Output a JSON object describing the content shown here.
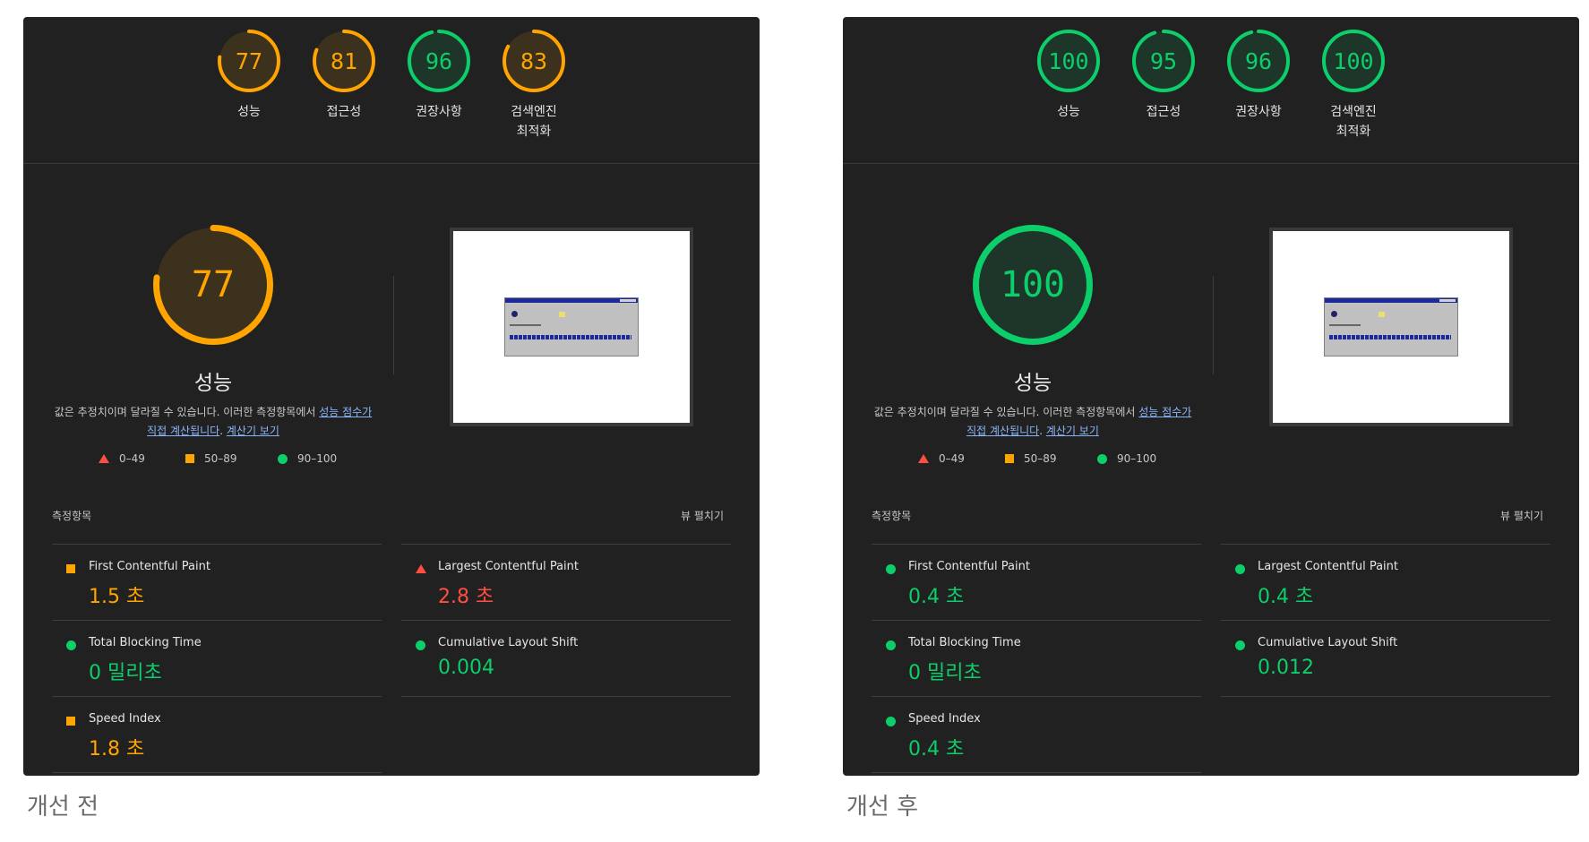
{
  "colors": {
    "pass": "#0cce6b",
    "average": "#ffa400",
    "fail": "#ff4e42",
    "panel_bg": "#212121"
  },
  "panels": [
    {
      "caption": "개선 전",
      "categories": [
        {
          "score": "77",
          "label": "성능",
          "status": "average",
          "fraction": 0.77
        },
        {
          "score": "81",
          "label": "접근성",
          "status": "average",
          "fraction": 0.81
        },
        {
          "score": "96",
          "label": "권장사항",
          "status": "pass",
          "fraction": 0.96
        },
        {
          "score": "83",
          "label": "검색엔진\n최적화",
          "status": "average",
          "fraction": 0.83
        }
      ],
      "performance": {
        "score": "77",
        "status": "average",
        "fraction": 0.77,
        "title": "성능",
        "desc_prefix": "값은 추정치이며 달라질 수 있습니다. 이러한 측정항목에서 ",
        "desc_link1": "성능 점수가 직접 계산됩니다",
        "desc_mid": ". ",
        "desc_link2": "계산기 보기"
      },
      "legend": {
        "fail": "0–49",
        "average": "50–89",
        "pass": "90–100"
      },
      "metrics_title": "측정항목",
      "expand_label": "뷰 펼치기",
      "metrics": {
        "fcp": {
          "name": "First Contentful Paint",
          "value": "1.5 초",
          "status": "average"
        },
        "lcp": {
          "name": "Largest Contentful Paint",
          "value": "2.8 초",
          "status": "fail"
        },
        "tbt": {
          "name": "Total Blocking Time",
          "value": "0 밀리초",
          "status": "pass"
        },
        "cls": {
          "name": "Cumulative Layout Shift",
          "value": "0.004",
          "status": "pass"
        },
        "si": {
          "name": "Speed Index",
          "value": "1.8 초",
          "status": "average"
        }
      }
    },
    {
      "caption": "개선 후",
      "categories": [
        {
          "score": "100",
          "label": "성능",
          "status": "pass",
          "fraction": 1.0
        },
        {
          "score": "95",
          "label": "접근성",
          "status": "pass",
          "fraction": 0.95
        },
        {
          "score": "96",
          "label": "권장사항",
          "status": "pass",
          "fraction": 0.96
        },
        {
          "score": "100",
          "label": "검색엔진\n최적화",
          "status": "pass",
          "fraction": 1.0
        }
      ],
      "performance": {
        "score": "100",
        "status": "pass",
        "fraction": 1.0,
        "title": "성능",
        "desc_prefix": "값은 추정치이며 달라질 수 있습니다. 이러한 측정항목에서 ",
        "desc_link1": "성능 점수가 직접 계산됩니다",
        "desc_mid": ". ",
        "desc_link2": "계산기 보기"
      },
      "legend": {
        "fail": "0–49",
        "average": "50–89",
        "pass": "90–100"
      },
      "metrics_title": "측정항목",
      "expand_label": "뷰 펼치기",
      "metrics": {
        "fcp": {
          "name": "First Contentful Paint",
          "value": "0.4 초",
          "status": "pass"
        },
        "lcp": {
          "name": "Largest Contentful Paint",
          "value": "0.4 초",
          "status": "pass"
        },
        "tbt": {
          "name": "Total Blocking Time",
          "value": "0 밀리초",
          "status": "pass"
        },
        "cls": {
          "name": "Cumulative Layout Shift",
          "value": "0.012",
          "status": "pass"
        },
        "si": {
          "name": "Speed Index",
          "value": "0.4 초",
          "status": "pass"
        }
      }
    }
  ]
}
